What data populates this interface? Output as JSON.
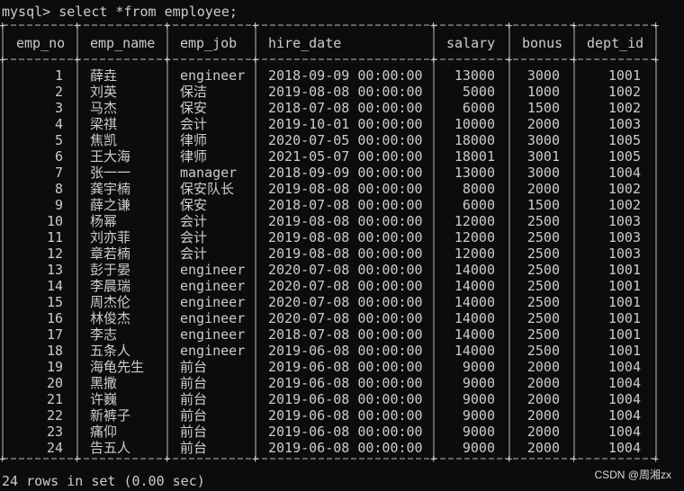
{
  "prompt": "mysql> select *from employee;",
  "table": {
    "columns": [
      "emp_no",
      "emp_name",
      "emp_job",
      "hire_date",
      "salary",
      "bonus",
      "dept_id"
    ],
    "rows": [
      [
        "1",
        "薛垚",
        "engineer",
        "2018-09-09 00:00:00",
        "13000",
        "3000",
        "1001"
      ],
      [
        "2",
        "刘英",
        "保洁",
        "2019-08-08 00:00:00",
        "5000",
        "1000",
        "1002"
      ],
      [
        "3",
        "马杰",
        "保安",
        "2018-07-08 00:00:00",
        "6000",
        "1500",
        "1002"
      ],
      [
        "4",
        "梁祺",
        "会计",
        "2019-10-01 00:00:00",
        "10000",
        "2000",
        "1003"
      ],
      [
        "5",
        "焦凯",
        "律师",
        "2020-07-05 00:00:00",
        "18000",
        "3000",
        "1005"
      ],
      [
        "6",
        "王大海",
        "律师",
        "2021-05-07 00:00:00",
        "18001",
        "3001",
        "1005"
      ],
      [
        "7",
        "张一一",
        "manager",
        "2018-09-09 00:00:00",
        "13000",
        "3000",
        "1004"
      ],
      [
        "8",
        "龚宇楠",
        "保安队长",
        "2019-08-08 00:00:00",
        "8000",
        "2000",
        "1002"
      ],
      [
        "9",
        "薛之谦",
        "保安",
        "2018-07-08 00:00:00",
        "6000",
        "1500",
        "1002"
      ],
      [
        "10",
        "杨幂",
        "会计",
        "2019-08-08 00:00:00",
        "12000",
        "2500",
        "1003"
      ],
      [
        "11",
        "刘亦菲",
        "会计",
        "2019-08-08 00:00:00",
        "12000",
        "2500",
        "1003"
      ],
      [
        "12",
        "章若楠",
        "会计",
        "2019-08-08 00:00:00",
        "12000",
        "2500",
        "1003"
      ],
      [
        "13",
        "彭于晏",
        "engineer",
        "2020-07-08 00:00:00",
        "14000",
        "2500",
        "1001"
      ],
      [
        "14",
        "李晨瑞",
        "engineer",
        "2020-07-08 00:00:00",
        "14000",
        "2500",
        "1001"
      ],
      [
        "15",
        "周杰伦",
        "engineer",
        "2020-07-08 00:00:00",
        "14000",
        "2500",
        "1001"
      ],
      [
        "16",
        "林俊杰",
        "engineer",
        "2020-07-08 00:00:00",
        "14000",
        "2500",
        "1001"
      ],
      [
        "17",
        "李志",
        "engineer",
        "2018-07-08 00:00:00",
        "14000",
        "2500",
        "1001"
      ],
      [
        "18",
        "五条人",
        "engineer",
        "2019-06-08 00:00:00",
        "14000",
        "2500",
        "1001"
      ],
      [
        "19",
        "海龟先生",
        "前台",
        "2019-06-08 00:00:00",
        "9000",
        "2000",
        "1004"
      ],
      [
        "20",
        "黑撒",
        "前台",
        "2019-06-08 00:00:00",
        "9000",
        "2000",
        "1004"
      ],
      [
        "21",
        "许巍",
        "前台",
        "2019-06-08 00:00:00",
        "9000",
        "2000",
        "1004"
      ],
      [
        "22",
        "新裤子",
        "前台",
        "2019-06-08 00:00:00",
        "9000",
        "2000",
        "1004"
      ],
      [
        "23",
        "痛仰",
        "前台",
        "2019-06-08 00:00:00",
        "9000",
        "2000",
        "1004"
      ],
      [
        "24",
        "告五人",
        "前台",
        "2019-06-08 00:00:00",
        "9000",
        "2000",
        "1004"
      ]
    ]
  },
  "footer": "24 rows in set (0.00 sec)",
  "watermark": "CSDN @周湘zx"
}
